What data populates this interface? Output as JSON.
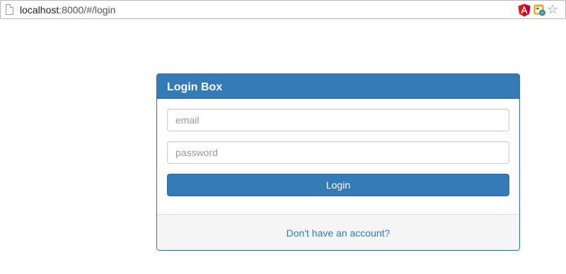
{
  "browser": {
    "url_host": "localhost",
    "url_rest": ":8000/#/login",
    "icons": [
      "page-icon",
      "angular-extension-icon",
      "extension-tool-icon",
      "star-icon"
    ]
  },
  "login": {
    "title": "Login Box",
    "email_placeholder": "email",
    "password_placeholder": "password",
    "button_label": "Login",
    "signup_link": "Don't have an account?"
  },
  "colors": {
    "primary": "#337ab7",
    "primary_border": "#2e6da4",
    "footer_bg": "#f5f5f5"
  }
}
